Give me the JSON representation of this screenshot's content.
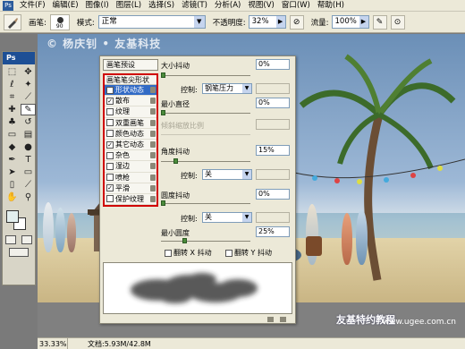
{
  "menubar": {
    "items": [
      "文件(F)",
      "编辑(E)",
      "图像(I)",
      "图层(L)",
      "选择(S)",
      "滤镜(T)",
      "分析(A)",
      "视图(V)",
      "窗口(W)",
      "帮助(H)"
    ]
  },
  "options": {
    "brush_label": "画笔:",
    "brush_size": "90",
    "mode_label": "模式:",
    "mode_value": "正常",
    "opacity_label": "不透明度:",
    "opacity_value": "32%",
    "flow_label": "流量:",
    "flow_value": "100%"
  },
  "toolbox": {
    "logo": "Ps"
  },
  "canvas": {
    "watermark_top": "© 杨庆钊 • 友基科技",
    "watermark_bottom": "友基特约教程",
    "watermark_url": "www.ugee.com.cn"
  },
  "status": {
    "zoom": "33.33%",
    "doc": "文档:5.93M/42.8M"
  },
  "brushes": {
    "presets_label": "画笔预设",
    "tip_shape_label": "画笔笔尖形状",
    "options": [
      {
        "label": "形状动态",
        "checked": true,
        "selected": true
      },
      {
        "label": "散布",
        "checked": true,
        "selected": false
      },
      {
        "label": "纹理",
        "checked": false,
        "selected": false
      },
      {
        "label": "双重画笔",
        "checked": false,
        "selected": false
      },
      {
        "label": "颜色动态",
        "checked": false,
        "selected": false
      },
      {
        "label": "其它动态",
        "checked": true,
        "selected": false
      },
      {
        "label": "杂色",
        "checked": false,
        "selected": false
      },
      {
        "label": "湿边",
        "checked": false,
        "selected": false
      },
      {
        "label": "喷枪",
        "checked": false,
        "selected": false
      },
      {
        "label": "平滑",
        "checked": true,
        "selected": false
      },
      {
        "label": "保护纹理",
        "checked": false,
        "selected": false
      }
    ],
    "size_jitter_label": "大小抖动",
    "size_jitter_value": "0%",
    "size_jitter_level": 0,
    "control_label": "控制:",
    "size_control_value": "钢笔压力",
    "min_diameter_label": "最小直径",
    "min_diameter_value": "0%",
    "min_diameter_level": 0,
    "tilt_scale_label": "倾斜缩放比例",
    "angle_jitter_label": "角度抖动",
    "angle_jitter_value": "15%",
    "angle_jitter_level": 15,
    "angle_control_value": "关",
    "roundness_jitter_label": "圆度抖动",
    "roundness_jitter_value": "0%",
    "roundness_jitter_level": 0,
    "roundness_control_value": "关",
    "min_roundness_label": "最小圆度",
    "min_roundness_value": "25%",
    "min_roundness_level": 25,
    "flip_x_label": "翻转 X 抖动",
    "flip_y_label": "翻转 Y 抖动"
  }
}
